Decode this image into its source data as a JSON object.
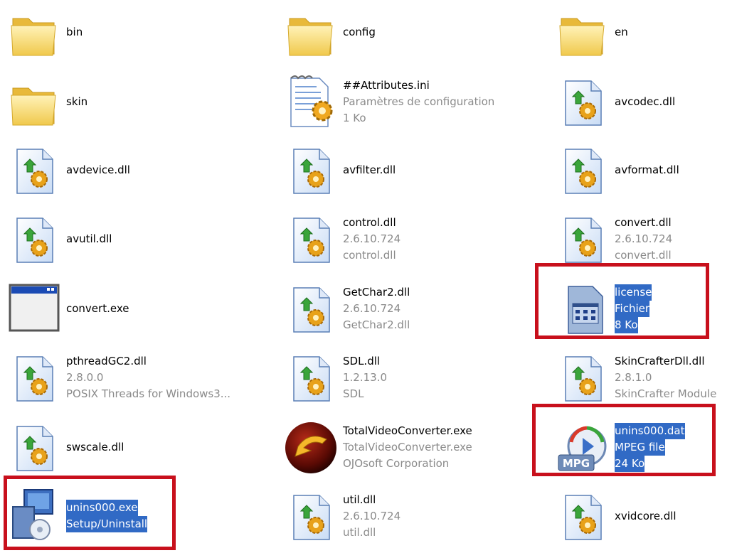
{
  "items": [
    {
      "name": "bin",
      "lines": [],
      "icon": "folder-icon"
    },
    {
      "name": "config",
      "lines": [],
      "icon": "folder-icon"
    },
    {
      "name": "en",
      "lines": [],
      "icon": "folder-icon"
    },
    {
      "name": "skin",
      "lines": [],
      "icon": "folder-icon"
    },
    {
      "name": "##Attributes.ini",
      "lines": [
        "Paramètres de configuration",
        "1 Ko"
      ],
      "icon": "ini-settings-icon"
    },
    {
      "name": "avcodec.dll",
      "lines": [],
      "icon": "dll-icon"
    },
    {
      "name": "avdevice.dll",
      "lines": [],
      "icon": "dll-icon"
    },
    {
      "name": "avfilter.dll",
      "lines": [],
      "icon": "dll-icon"
    },
    {
      "name": "avformat.dll",
      "lines": [],
      "icon": "dll-icon"
    },
    {
      "name": "avutil.dll",
      "lines": [],
      "icon": "dll-icon"
    },
    {
      "name": "control.dll",
      "lines": [
        "2.6.10.724",
        "control.dll"
      ],
      "icon": "dll-icon"
    },
    {
      "name": "convert.dll",
      "lines": [
        "2.6.10.724",
        "convert.dll"
      ],
      "icon": "dll-icon"
    },
    {
      "name": "convert.exe",
      "lines": [],
      "icon": "application-window-icon"
    },
    {
      "name": "GetChar2.dll",
      "lines": [
        "2.6.10.724",
        "GetChar2.dll"
      ],
      "icon": "dll-icon"
    },
    {
      "name": "license",
      "lines": [
        "Fichier",
        "8 Ko"
      ],
      "icon": "generic-file-icon"
    },
    {
      "name": "pthreadGC2.dll",
      "lines": [
        "2.8.0.0",
        "POSIX Threads for Windows3..."
      ],
      "icon": "dll-icon"
    },
    {
      "name": "SDL.dll",
      "lines": [
        "1.2.13.0",
        "SDL"
      ],
      "icon": "dll-icon"
    },
    {
      "name": "SkinCrafterDll.dll",
      "lines": [
        "2.8.1.0",
        "SkinCrafter Module"
      ],
      "icon": "dll-icon"
    },
    {
      "name": "swscale.dll",
      "lines": [],
      "icon": "dll-icon"
    },
    {
      "name": "TotalVideoConverter.exe",
      "lines": [
        "TotalVideoConverter.exe",
        "OJOsoft Corporation"
      ],
      "icon": "total-video-converter-icon"
    },
    {
      "name": "unins000.dat",
      "lines": [
        "MPEG file",
        "24 Ko"
      ],
      "icon": "mpg-file-icon"
    },
    {
      "name": "unins000.exe",
      "lines": [
        "Setup/Uninstall"
      ],
      "icon": "setup-uninstall-icon"
    },
    {
      "name": "util.dll",
      "lines": [
        "2.6.10.724",
        "util.dll"
      ],
      "icon": "dll-icon"
    },
    {
      "name": "xvidcore.dll",
      "lines": [],
      "icon": "dll-icon"
    }
  ],
  "icon_labels": {
    "mpg": "MPG"
  },
  "colors": {
    "selection": "#316ac5",
    "highlight_box": "#c8101c",
    "folder": "#f5d77c",
    "subtext": "#8a8a8a"
  }
}
